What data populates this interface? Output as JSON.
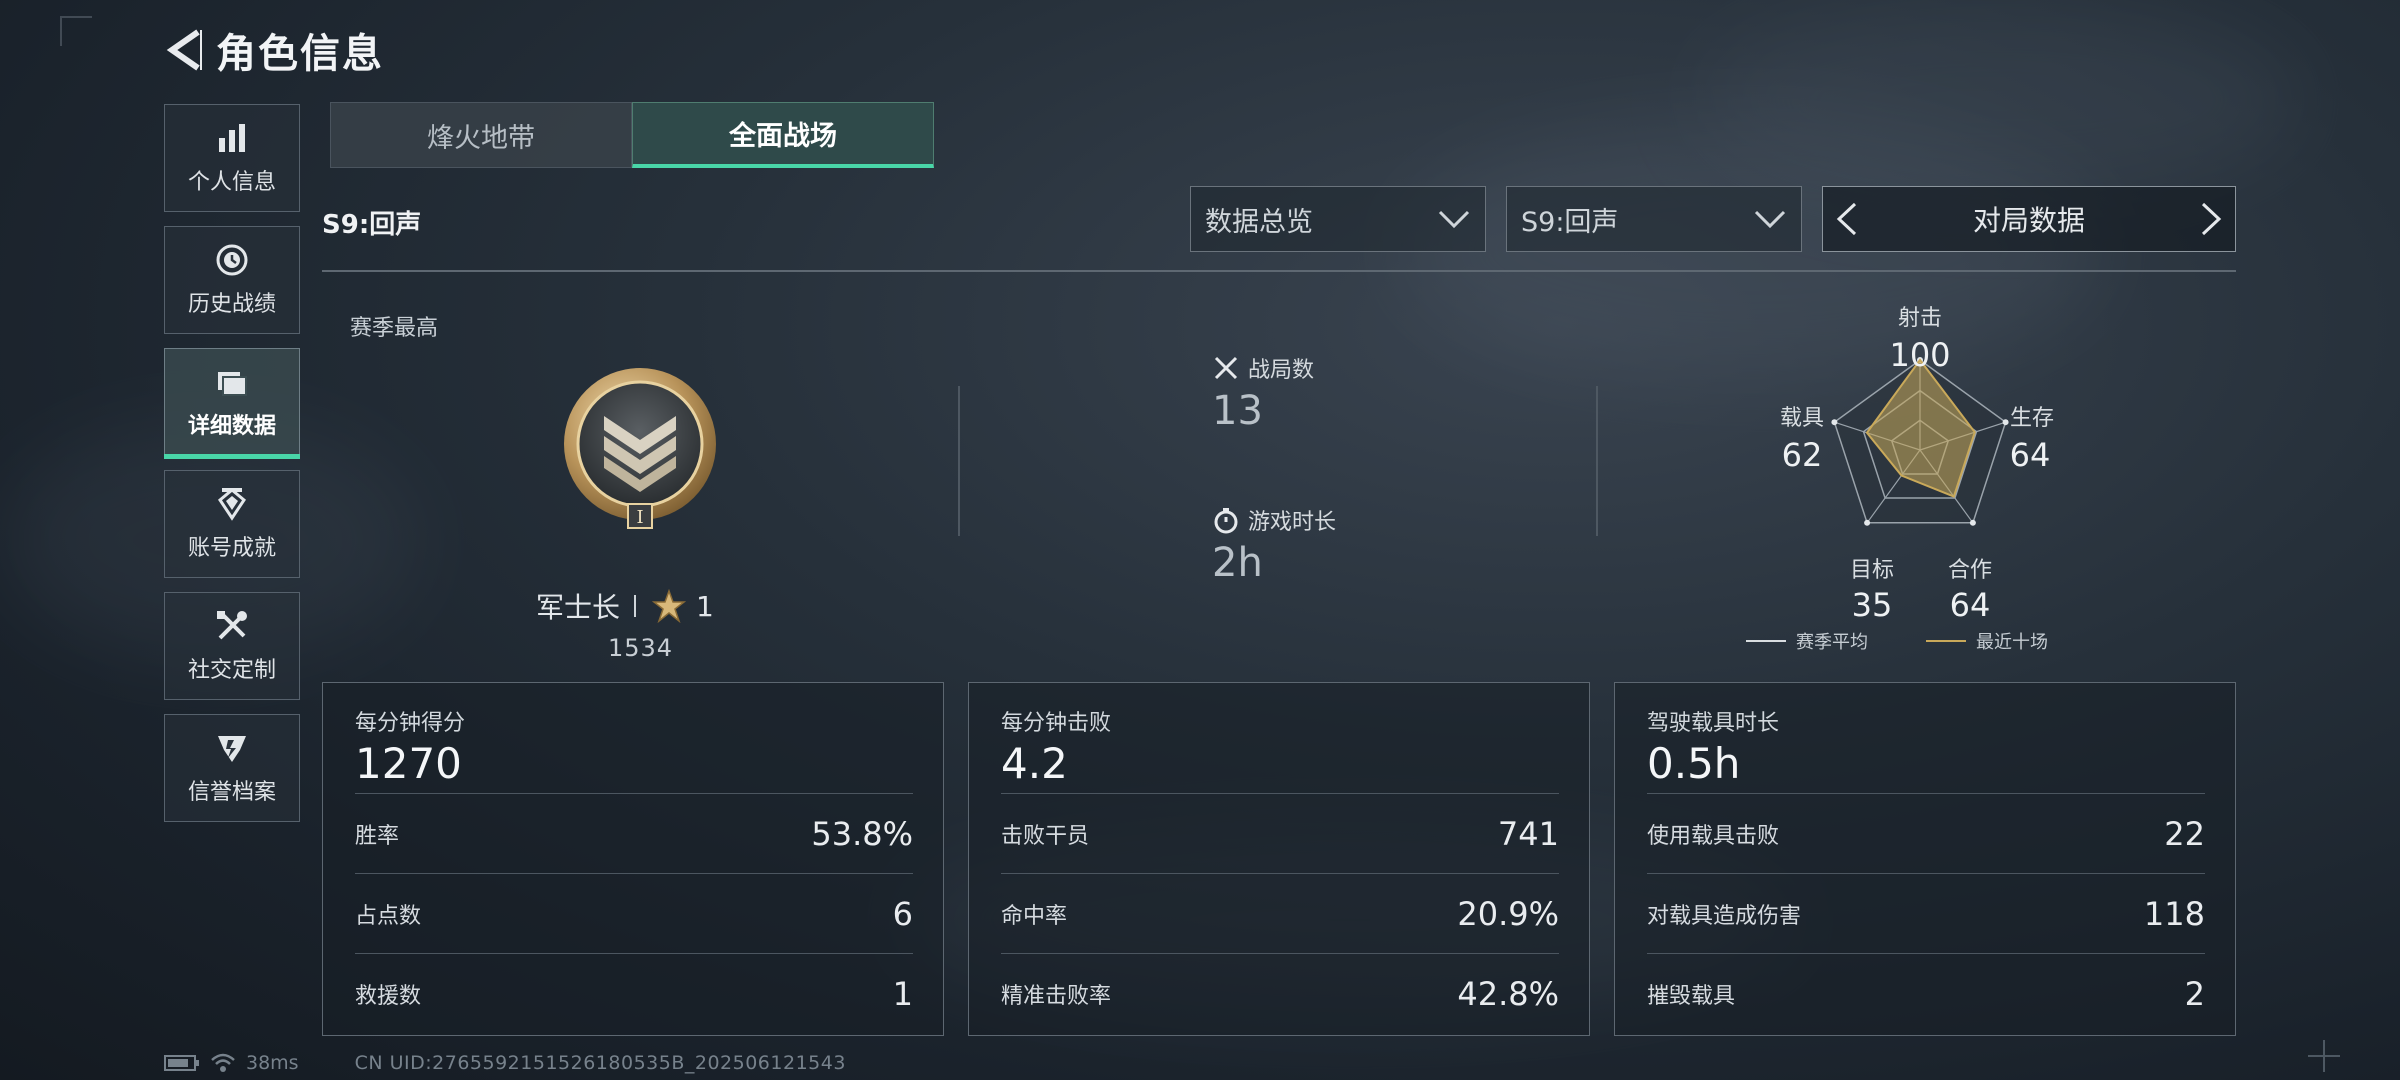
{
  "header": {
    "title": "角色信息"
  },
  "sidebar": {
    "items": [
      {
        "label": "个人信息",
        "icon": "bar-chart-icon",
        "active": false
      },
      {
        "label": "历史战绩",
        "icon": "clock-icon",
        "active": false
      },
      {
        "label": "详细数据",
        "icon": "folder-icon",
        "active": true
      },
      {
        "label": "账号成就",
        "icon": "achievement-icon",
        "active": false
      },
      {
        "label": "社交定制",
        "icon": "tools-icon",
        "active": false
      },
      {
        "label": "信誉档案",
        "icon": "shield-icon",
        "active": false
      }
    ]
  },
  "tabs": [
    {
      "label": "烽火地带",
      "active": false
    },
    {
      "label": "全面战场",
      "active": true
    }
  ],
  "filters": {
    "season_title": "S9:回声",
    "dropdown_view": "数据总览",
    "dropdown_season": "S9:回声",
    "pager_label": "对局数据"
  },
  "overview": {
    "season_best_label": "赛季最高",
    "rank_name": "军士长",
    "rank_stars": "1",
    "rank_score": "1534",
    "rank_badge_numeral": "I",
    "matches_label": "战局数",
    "matches_value": "13",
    "playtime_label": "游戏时长",
    "playtime_value": "2h"
  },
  "radar": {
    "axes": [
      {
        "label": "射击",
        "value": "100"
      },
      {
        "label": "生存",
        "value": "64"
      },
      {
        "label": "合作",
        "value": "64"
      },
      {
        "label": "目标",
        "value": "35"
      },
      {
        "label": "载具",
        "value": "62"
      }
    ],
    "legend": [
      {
        "label": "赛季平均",
        "color": "#d9dde0"
      },
      {
        "label": "最近十场",
        "color": "#c9a95a"
      }
    ]
  },
  "cards": [
    {
      "title": "每分钟得分",
      "main": "1270",
      "rows": [
        {
          "label": "胜率",
          "value": "53.8%"
        },
        {
          "label": "占点数",
          "value": "6"
        },
        {
          "label": "救援数",
          "value": "1"
        }
      ]
    },
    {
      "title": "每分钟击败",
      "main": "4.2",
      "rows": [
        {
          "label": "击败干员",
          "value": "741"
        },
        {
          "label": "命中率",
          "value": "20.9%"
        },
        {
          "label": "精准击败率",
          "value": "42.8%"
        }
      ]
    },
    {
      "title": "驾驶载具时长",
      "main": "0.5h",
      "rows": [
        {
          "label": "使用载具击败",
          "value": "22"
        },
        {
          "label": "对载具造成伤害",
          "value": "118"
        },
        {
          "label": "摧毁载具",
          "value": "2"
        }
      ]
    }
  ],
  "status": {
    "ping": "38ms",
    "uid": "CN UID:2765592151526180535B_202506121543"
  },
  "colors": {
    "accent": "#49d6a8",
    "gold": "#c9a95a"
  }
}
